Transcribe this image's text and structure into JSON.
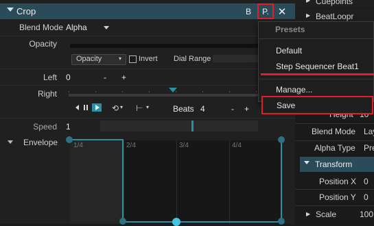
{
  "colors": {
    "accent": "#2a4b5a",
    "highlight": "#e11f2a",
    "teal": "#2b8fa6"
  },
  "crop": {
    "title": "Crop",
    "b_label": "B",
    "p_label": "P."
  },
  "labels": {
    "blend_mode": "Blend Mode",
    "opacity": "Opacity",
    "left": "Left",
    "right": "Right",
    "speed": "Speed",
    "envelope": "Envelope"
  },
  "values": {
    "blend_mode": "Alpha",
    "left": "0",
    "speed": "1",
    "beats": "Beats",
    "beats_value": "4"
  },
  "opacity_row": {
    "dropdown": "Opacity",
    "invert": "Invert",
    "dial_range": "Dial Range"
  },
  "pm": {
    "minus": "-",
    "plus": "+"
  },
  "envelope": {
    "marks": [
      "1/4",
      "2/4",
      "3/4",
      "4/4"
    ]
  },
  "menu": {
    "title": "Presets",
    "items": [
      "Default",
      "Step Sequencer Beat1",
      "Manage...",
      "Save"
    ]
  },
  "right_panel": {
    "items": [
      "Cuepoints",
      "BeatLoopr",
      "Height",
      "Blend Mode",
      "Alpha Type",
      "Transform",
      "Position X",
      "Position Y",
      "Scale"
    ],
    "values": [
      "10",
      "Lay",
      "Pre",
      "0",
      "0",
      "100"
    ]
  },
  "icons": {
    "collapse": "triangle-down-icon",
    "play": "play-icon",
    "pause": "pause-icon",
    "loop": "loop-icon",
    "close": "close-icon"
  }
}
